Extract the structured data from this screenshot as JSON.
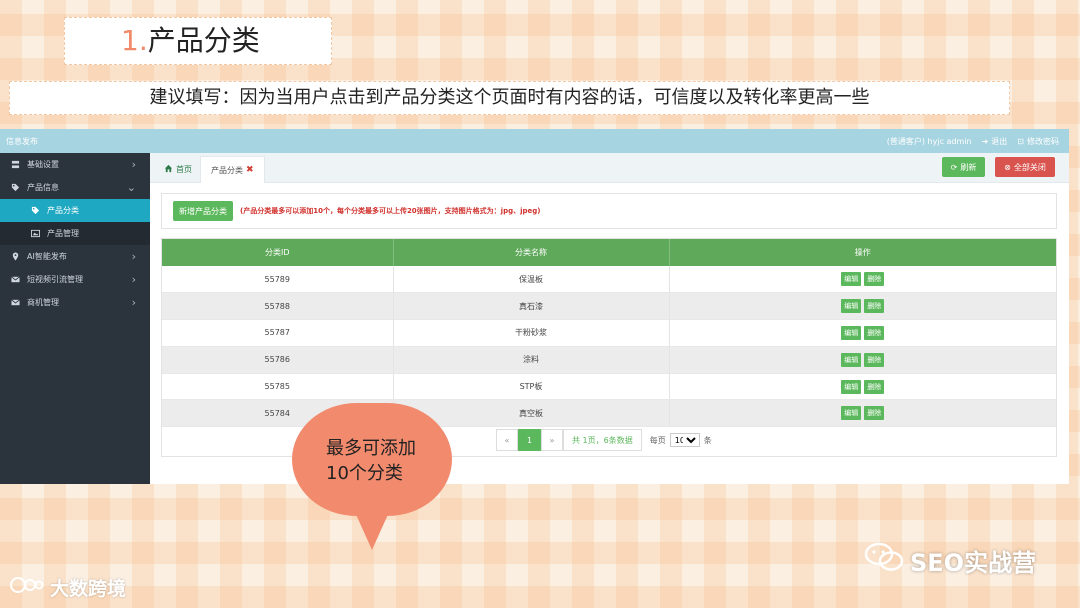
{
  "slide": {
    "title_num": "1.",
    "title": "产品分类",
    "note": "建议填写：因为当用户点击到产品分类这个页面时有内容的话，可信度以及转化率更高一些",
    "callout_line1": "最多可添加",
    "callout_line2": "10个分类",
    "watermark_left": "大数跨境",
    "watermark_right": "SEO实战营"
  },
  "app": {
    "topbar_title": "信息发布",
    "user": "(普通客户) hyjc admin",
    "logout": "退出",
    "change_password": "修改密码",
    "sidebar": [
      {
        "label": "基础设置",
        "icon": "server-icon",
        "chevron": "›"
      },
      {
        "label": "产品信息",
        "icon": "tag-icon",
        "chevron": "⌄"
      },
      {
        "label": "产品分类",
        "icon": "tags-icon",
        "sub": true,
        "active": true
      },
      {
        "label": "产品管理",
        "icon": "image-icon",
        "sub": true
      },
      {
        "label": "AI智能发布",
        "icon": "location-icon",
        "chevron": "›"
      },
      {
        "label": "短视频引流管理",
        "icon": "mail-icon",
        "chevron": "›"
      },
      {
        "label": "商机管理",
        "icon": "mail-icon",
        "chevron": "›"
      }
    ],
    "tabs": {
      "home": "首页",
      "current": "产品分类"
    },
    "refresh_label": "刷新",
    "close_all_label": "全部关闭",
    "add_button": "新增产品分类",
    "hint": "(产品分类最多可以添加10个，每个分类最多可以上传20张图片，支持图片格式为：jpg、jpeg)",
    "table": {
      "headers": [
        "分类ID",
        "分类名称",
        "操作"
      ],
      "rows": [
        {
          "id": "55789",
          "name": "保温板"
        },
        {
          "id": "55788",
          "name": "真石漆"
        },
        {
          "id": "55787",
          "name": "干粉砂浆"
        },
        {
          "id": "55786",
          "name": "涂料"
        },
        {
          "id": "55785",
          "name": "STP板"
        },
        {
          "id": "55784",
          "name": "真空板"
        }
      ],
      "edit_label": "编辑",
      "delete_label": "删除"
    },
    "pager": {
      "prev": "«",
      "current": "1",
      "next": "»",
      "info": "共 1页，6条数据",
      "per_page_label": "每页",
      "per_page_value": "10",
      "unit": "条"
    }
  },
  "colors": {
    "primary_green": "#5cb85c",
    "danger_red": "#d9534f",
    "sidebar_bg": "#2b333d",
    "active_item": "#1fa8c2",
    "callout": "#f28a6d"
  }
}
